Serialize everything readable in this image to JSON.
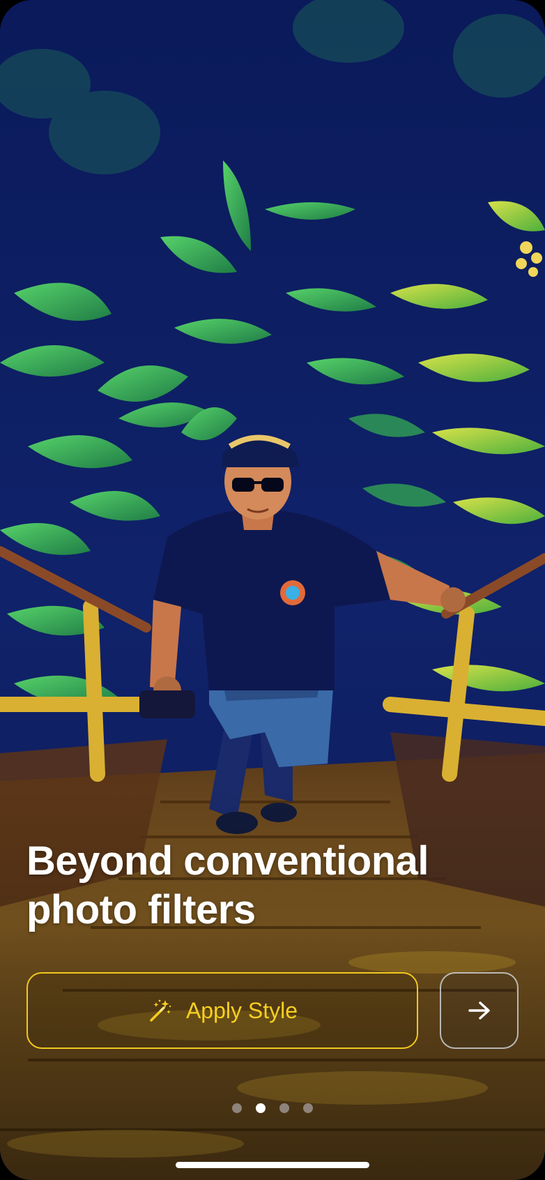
{
  "onboarding": {
    "headline_line1": "Beyond conventional",
    "headline_line2": "photo filters",
    "apply_button_label": "Apply Style",
    "apply_button_icon": "magic-wand-icon",
    "next_button_icon": "arrow-right-icon",
    "page_indicator": {
      "total_pages": 4,
      "current_page": 2
    }
  },
  "colors": {
    "accent_yellow": "#f7cf1f",
    "headline_text": "#ffffff",
    "background_deep_blue": "#0b1a55",
    "foliage_green": "#2fa84a"
  }
}
